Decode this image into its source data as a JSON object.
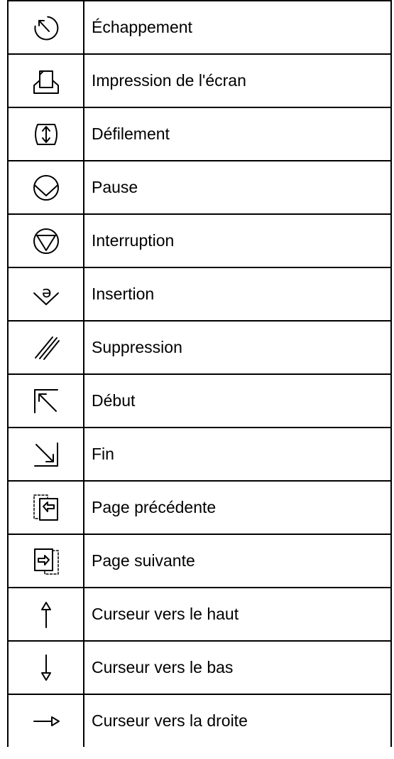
{
  "rows": [
    {
      "icon": "escape-icon",
      "label": "Échappement"
    },
    {
      "icon": "print-screen-icon",
      "label": "Impression de l'écran"
    },
    {
      "icon": "scroll-icon",
      "label": "Défilement"
    },
    {
      "icon": "pause-icon",
      "label": "Pause"
    },
    {
      "icon": "interrupt-icon",
      "label": "Interruption"
    },
    {
      "icon": "insert-icon",
      "label": "Insertion"
    },
    {
      "icon": "delete-icon",
      "label": "Suppression"
    },
    {
      "icon": "home-icon",
      "label": "Début"
    },
    {
      "icon": "end-icon",
      "label": "Fin"
    },
    {
      "icon": "page-up-icon",
      "label": "Page précédente"
    },
    {
      "icon": "page-down-icon",
      "label": "Page suivante"
    },
    {
      "icon": "cursor-up-icon",
      "label": "Curseur vers le haut"
    },
    {
      "icon": "cursor-down-icon",
      "label": "Curseur vers le bas"
    },
    {
      "icon": "cursor-right-icon",
      "label": "Curseur vers la droite"
    }
  ]
}
